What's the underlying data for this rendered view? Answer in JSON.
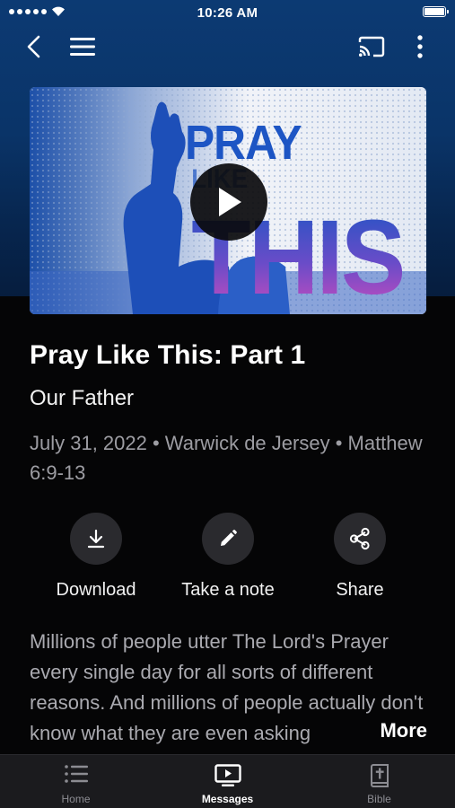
{
  "status_bar": {
    "time": "10:26 AM"
  },
  "hero": {
    "artwork_line1": "PRAY",
    "artwork_line2": "LIKE",
    "artwork_line3": "THIS"
  },
  "message": {
    "title": "Pray Like This: Part 1",
    "subtitle": "Our Father",
    "meta": "July 31, 2022 • Warwick de Jersey • Matthew 6:9-13"
  },
  "actions": [
    {
      "label": "Download",
      "icon": "download-icon"
    },
    {
      "label": "Take a note",
      "icon": "pencil-icon"
    },
    {
      "label": "Share",
      "icon": "share-icon"
    }
  ],
  "description": {
    "text": "Millions of people utter The Lord's Prayer every single day for all sorts of different reasons. And millions of people actually don't know what they are even asking",
    "more_label": "More"
  },
  "tabs": [
    {
      "label": "Home",
      "icon": "list-icon",
      "active": false
    },
    {
      "label": "Messages",
      "icon": "tv-play-icon",
      "active": true
    },
    {
      "label": "Bible",
      "icon": "bible-icon",
      "active": false
    }
  ],
  "colors": {
    "header_blue": "#0c3a73",
    "background": "#050506",
    "artwork_blue": "#1d55c4",
    "artwork_magenta": "#c24bc2"
  }
}
